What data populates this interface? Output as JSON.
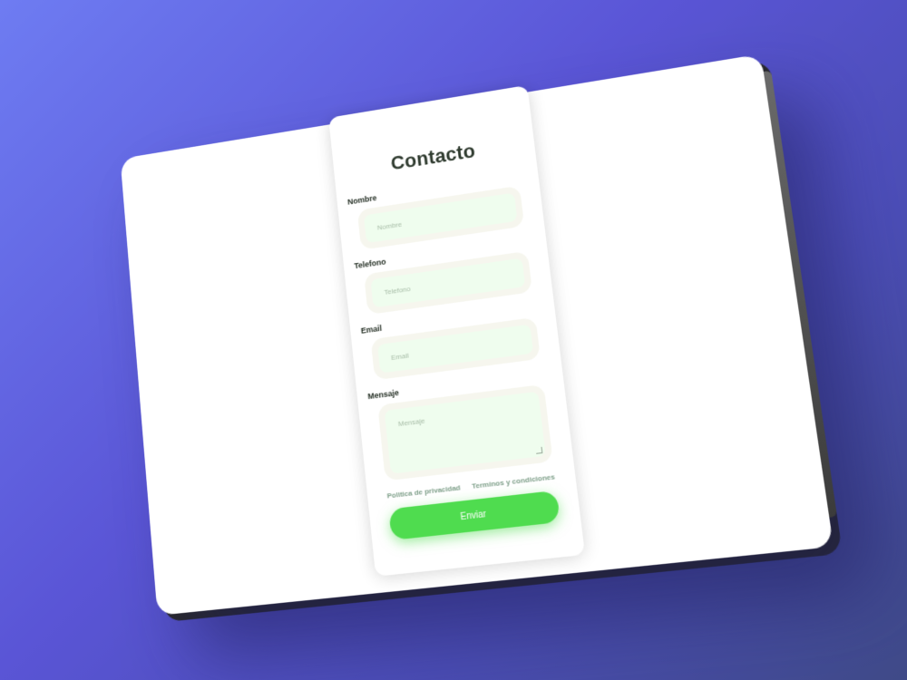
{
  "form": {
    "title": "Contacto",
    "fields": [
      {
        "label": "Nombre",
        "placeholder": "Nombre"
      },
      {
        "label": "Telefono",
        "placeholder": "Telefono"
      },
      {
        "label": "Email",
        "placeholder": "Email"
      },
      {
        "label": "Mensaje",
        "placeholder": "Mensaje"
      }
    ],
    "links": {
      "privacy": "Politica de privacidad",
      "terms": "Terminos y condiciones"
    },
    "submit_label": "Enviar"
  },
  "colors": {
    "background_start": "#6e7cf2",
    "background_end": "#3f4a88",
    "input_bg": "#effdee",
    "accent_green": "#4fdc4f",
    "link_color": "#7fa08a",
    "title_color": "#2e3a2e"
  }
}
